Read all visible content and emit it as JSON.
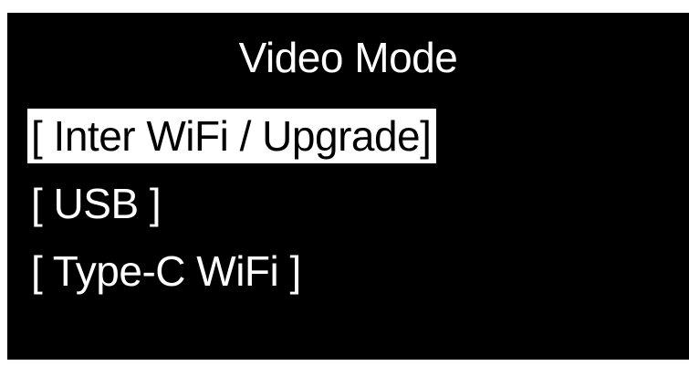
{
  "screen": {
    "title": "Video Mode",
    "selected_index": 0,
    "menu": [
      {
        "label": "[ Inter WiFi / Upgrade]",
        "selected": true
      },
      {
        "label": "[ USB ]",
        "selected": false
      },
      {
        "label": "[ Type-C WiFi ]",
        "selected": false
      }
    ]
  },
  "colors": {
    "background": "#000000",
    "text": "#ffffff",
    "highlight": "#ffffff",
    "highlight_text": "#000000"
  }
}
